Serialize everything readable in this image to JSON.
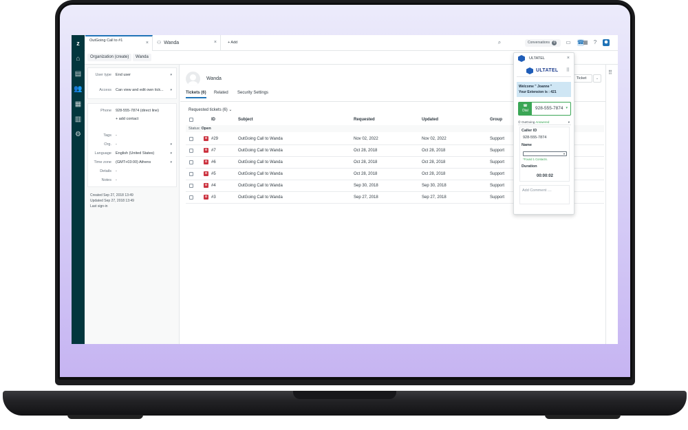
{
  "tabs": [
    {
      "label": "OutGoing Call to #1",
      "active": true
    },
    {
      "label": "Wanda",
      "active": false
    }
  ],
  "add_tab_label": "+ Add",
  "conversations": {
    "label": "Conversations",
    "count": "0"
  },
  "breadcrumb": [
    "Organization (create)",
    "Wanda"
  ],
  "user_fields": {
    "user_type": {
      "label": "User type",
      "value": "End user"
    },
    "access": {
      "label": "Access",
      "value": "Can view and edit own tick..."
    },
    "phone": {
      "label": "Phone",
      "value": "928-555-7874 (direct line)"
    },
    "add_contact": "+ add contact",
    "tags": {
      "label": "Tags",
      "value": "-"
    },
    "org": {
      "label": "Org.",
      "value": "-"
    },
    "language": {
      "label": "Language",
      "value": "English (United States)"
    },
    "timezone": {
      "label": "Time zone",
      "value": "(GMT+03:00) Athens"
    },
    "details": {
      "label": "Details",
      "value": "-"
    },
    "notes": {
      "label": "Notes",
      "value": "-"
    }
  },
  "meta": {
    "created": "Created  Sep 27, 2018 13:49",
    "updated": "Updated  Sep 27, 2018 13:49",
    "last_signin": "Last sign-in"
  },
  "profile": {
    "name": "Wanda"
  },
  "user_tabs": [
    "Tickets (6)",
    "Related",
    "Security Settings"
  ],
  "requested_label": "Requested tickets (6) ⌄",
  "new_ticket_label": "Ticket",
  "table": {
    "headers": [
      "ID",
      "Subject",
      "Requested",
      "Updated",
      "Group"
    ],
    "status_prefix": "Status:",
    "status_value": "Open",
    "rows": [
      {
        "badge": "o",
        "id": "#29",
        "subject": "OutGoing Call to Wanda",
        "requested": "Nov 02, 2022",
        "updated": "Nov 02, 2022",
        "group": "Support"
      },
      {
        "badge": "o",
        "id": "#7",
        "subject": "OutGoing Call to Wanda",
        "requested": "Oct 28, 2018",
        "updated": "Oct 28, 2018",
        "group": "Support"
      },
      {
        "badge": "o",
        "id": "#6",
        "subject": "OutGoing Call to Wanda",
        "requested": "Oct 28, 2018",
        "updated": "Oct 28, 2018",
        "group": "Support"
      },
      {
        "badge": "o",
        "id": "#5",
        "subject": "OutGoing Call to Wanda",
        "requested": "Oct 28, 2018",
        "updated": "Oct 28, 2018",
        "group": "Support"
      },
      {
        "badge": "o",
        "id": "#4",
        "subject": "OutGoing Call to Wanda",
        "requested": "Sep 30, 2018",
        "updated": "Sep 30, 2018",
        "group": "Support"
      },
      {
        "badge": "o",
        "id": "#3",
        "subject": "OutGoing Call to Wanda",
        "requested": "Sep 27, 2018",
        "updated": "Sep 27, 2018",
        "group": "Support"
      }
    ]
  },
  "ultatel": {
    "title": "ULTATEL",
    "brand": "ULTATEL",
    "welcome_line1": "Welcome \" Joanne \"",
    "welcome_line2": "Your Extension is : 421",
    "dial_label": "Dial",
    "dial_number": "928-555-7874",
    "call_status_prefix": "OutGoing",
    "call_status_value": "Answered",
    "caller_id_label": "Caller ID",
    "caller_id_value": "928-555-7874",
    "name_label": "Name",
    "found_contacts": "*Found 1 Contacts.",
    "duration_label": "Duration",
    "duration_value": "00:00:02",
    "comment_placeholder": "Add Comment ...."
  },
  "colors": {
    "nav": "#03363d",
    "accent": "#1f73b7",
    "success": "#3aa655",
    "badge_open": "#cc3340"
  }
}
